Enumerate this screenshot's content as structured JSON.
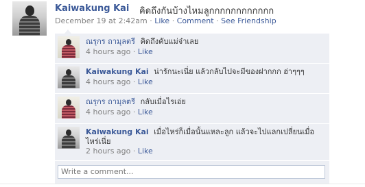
{
  "post": {
    "author": "Kaiwakung Kai",
    "text": "คิดถึงกันบ้างไหมลูกกกกกกกกกกกก",
    "time": "December 19 at 2:42am",
    "sep": "·",
    "like_label": "Like",
    "comment_label": "Comment",
    "friendship_label": "See Friendship",
    "avatar_icon": "profile-photo"
  },
  "comments": [
    {
      "author": "ณรุกร ถามุลตรี",
      "text": "คิดถึงคับแม่จ๋าเลย",
      "time": "4 hours ago",
      "like_label": "Like",
      "avatar_icon": "profile-photo-colored"
    },
    {
      "author": "Kaiwakung Kai",
      "text": "น่ารักนะเนี่ย แล้วกลับไปจะมีของฝากกก ฮ่าๆๆๆ",
      "time": "4 hours ago",
      "like_label": "Like",
      "avatar_icon": "profile-photo"
    },
    {
      "author": "ณรุกร ถามุลตรี",
      "text": "กลับเมื่อไรเอ่ย",
      "time": "4 hours ago",
      "like_label": "Like",
      "avatar_icon": "profile-photo-colored"
    },
    {
      "author": "Kaiwakung Kai",
      "text": "เมื่อไหร่ก็เมื่อนั้นแหละลูก แล้วจะไปแลกเปลี่ยนเมื่อไหร่เนี่ย",
      "time": "2 hours ago",
      "like_label": "Like",
      "avatar_icon": "profile-photo"
    }
  ],
  "write_comment": {
    "placeholder": "Write a comment..."
  },
  "colors": {
    "link": "#3b5998",
    "comment_bg": "#edeff4",
    "meta": "#808080"
  }
}
